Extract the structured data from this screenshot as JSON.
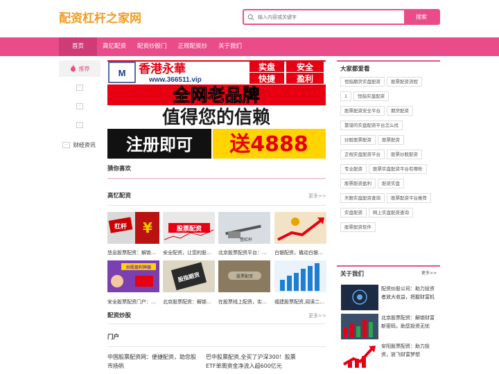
{
  "header": {
    "logo": "配资杠杆之家网",
    "search_placeholder": "输入内容或关键字",
    "search_button": "搜索"
  },
  "nav": {
    "items": [
      "首页",
      "高忆配资",
      "配资炒股门",
      "正规配资炒",
      "关于我们"
    ]
  },
  "left": {
    "recommend": "推荐",
    "fin": "财经资讯"
  },
  "banner": {
    "line1": "香港永華",
    "url": "www.366511.vip",
    "tags": [
      "实盘",
      "安全",
      "快捷",
      "盈利"
    ],
    "line2": "全网老品牌",
    "line3": "值得您的信赖",
    "line4a": "注册即可",
    "line4b": "送4888"
  },
  "sections": {
    "guess": "猜你喜欢",
    "gaoyi": "高忆配资",
    "more1": "更多>>",
    "peizi": "配资炒股",
    "more2": "更多>>",
    "portal": "门户"
  },
  "thumbs": [
    {
      "caption": "恁息股票配资：解锁…",
      "label": "杠杆"
    },
    {
      "caption": "安全配资，让您的股…",
      "label": "股票配资"
    },
    {
      "caption": "北京股票配资平台：…",
      "label": "借杠杆"
    },
    {
      "caption": "白银配资，撬动白银…",
      "label": ""
    },
    {
      "caption": "安全股票配资门户：…",
      "label": "炒股盈利神器"
    },
    {
      "caption": "北京股票配资：解锁…",
      "label": "股指期货"
    },
    {
      "caption": "在股票线上配资，实…",
      "label": "股票配资"
    },
    {
      "caption": "福建股票配资,阅读二…",
      "label": ""
    }
  ],
  "news": {
    "left": "中国股票配资网：便捷配资，助您股市扬帆",
    "right": "巴中股票配资,全买了沪深300！股票ETF单周资金净流入超600亿元"
  },
  "hot": {
    "title": "大家都爱看",
    "tags": [
      "恒指期货实盘配资",
      "股票配资流程",
      "1",
      "恒指实盘配资",
      "股票配资安全平台",
      "期货配资",
      "靠谱的实盘配资平台怎么找",
      "炒股股票配资",
      "股票配资",
      "正规实盘配资平台",
      "股票炒股配资",
      "专业配资",
      "股票实盘配资平台有哪些",
      "股票配资盈利",
      "配资实盘",
      "天眼实盘配资查询",
      "股票配资平台推荐",
      "实盘配资",
      "网上实盘配资查询",
      "股票配资软件"
    ]
  },
  "about": {
    "title": "关于我们",
    "more": "更多>>",
    "items": [
      "配资炒股公司：助力投资者放大收益，把握财富机",
      "北京股票配资：解锁财富新密码，助您投资无忧",
      "安阳股票配资：助力投资，放飞财富梦想"
    ]
  },
  "colors": {
    "accent": "#ea4c89",
    "logo": "#f39b1e",
    "banner_red": "#e60012"
  }
}
